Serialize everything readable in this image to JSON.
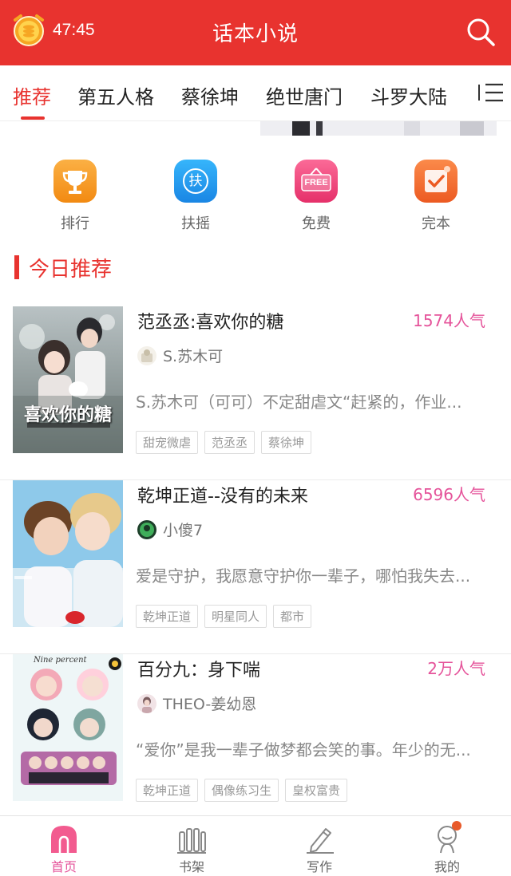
{
  "header": {
    "timer": "47:45",
    "title": "话本小说"
  },
  "tabs": [
    {
      "label": "推荐",
      "active": true
    },
    {
      "label": "第五人格"
    },
    {
      "label": "蔡徐坤"
    },
    {
      "label": "绝世唐门"
    },
    {
      "label": "斗罗大陆"
    }
  ],
  "quick_entries": [
    {
      "label": "排行",
      "icon": "trophy-icon",
      "color": "#f79a1e"
    },
    {
      "label": "扶摇",
      "icon_text": "扶",
      "icon": "fuyao-icon",
      "color": "#2a9ff0"
    },
    {
      "label": "免费",
      "icon_text": "FREE",
      "icon": "free-icon",
      "color": "#f0447a"
    },
    {
      "label": "完本",
      "icon": "checkmark-icon",
      "color": "#f36e2e"
    }
  ],
  "section": {
    "title": "今日推荐"
  },
  "books": [
    {
      "title": "范丞丞:喜欢你的糖",
      "popularity": "1574人气",
      "author": "S.苏木可",
      "description": "S.苏木可（可可）不定甜虐文“赶紧的，作业...",
      "tags": [
        "甜宠微虐",
        "范丞丞",
        "蔡徐坤"
      ],
      "cover_text": "喜欢你的糖"
    },
    {
      "title": "乾坤正道--没有的未来",
      "popularity": "6596人气",
      "author": "小傻7",
      "description": "爱是守护，我愿意守护你一辈子，哪怕我失去...",
      "tags": [
        "乾坤正道",
        "明星同人",
        "都市"
      ]
    },
    {
      "title": "百分九：身下喘",
      "popularity": "2万人气",
      "author": "THEO-姜幼恩",
      "description": "“爱你”是我一辈子做梦都会笑的事。年少的无...",
      "tags": [
        "乾坤正道",
        "偶像练习生",
        "皇权富贵"
      ],
      "cover_text": "Nine percent"
    }
  ],
  "bottom_nav": [
    {
      "label": "首页",
      "active": true
    },
    {
      "label": "书架"
    },
    {
      "label": "写作"
    },
    {
      "label": "我的"
    }
  ],
  "colors": {
    "primary": "#e8332f",
    "accent_pink": "#e5539a"
  }
}
